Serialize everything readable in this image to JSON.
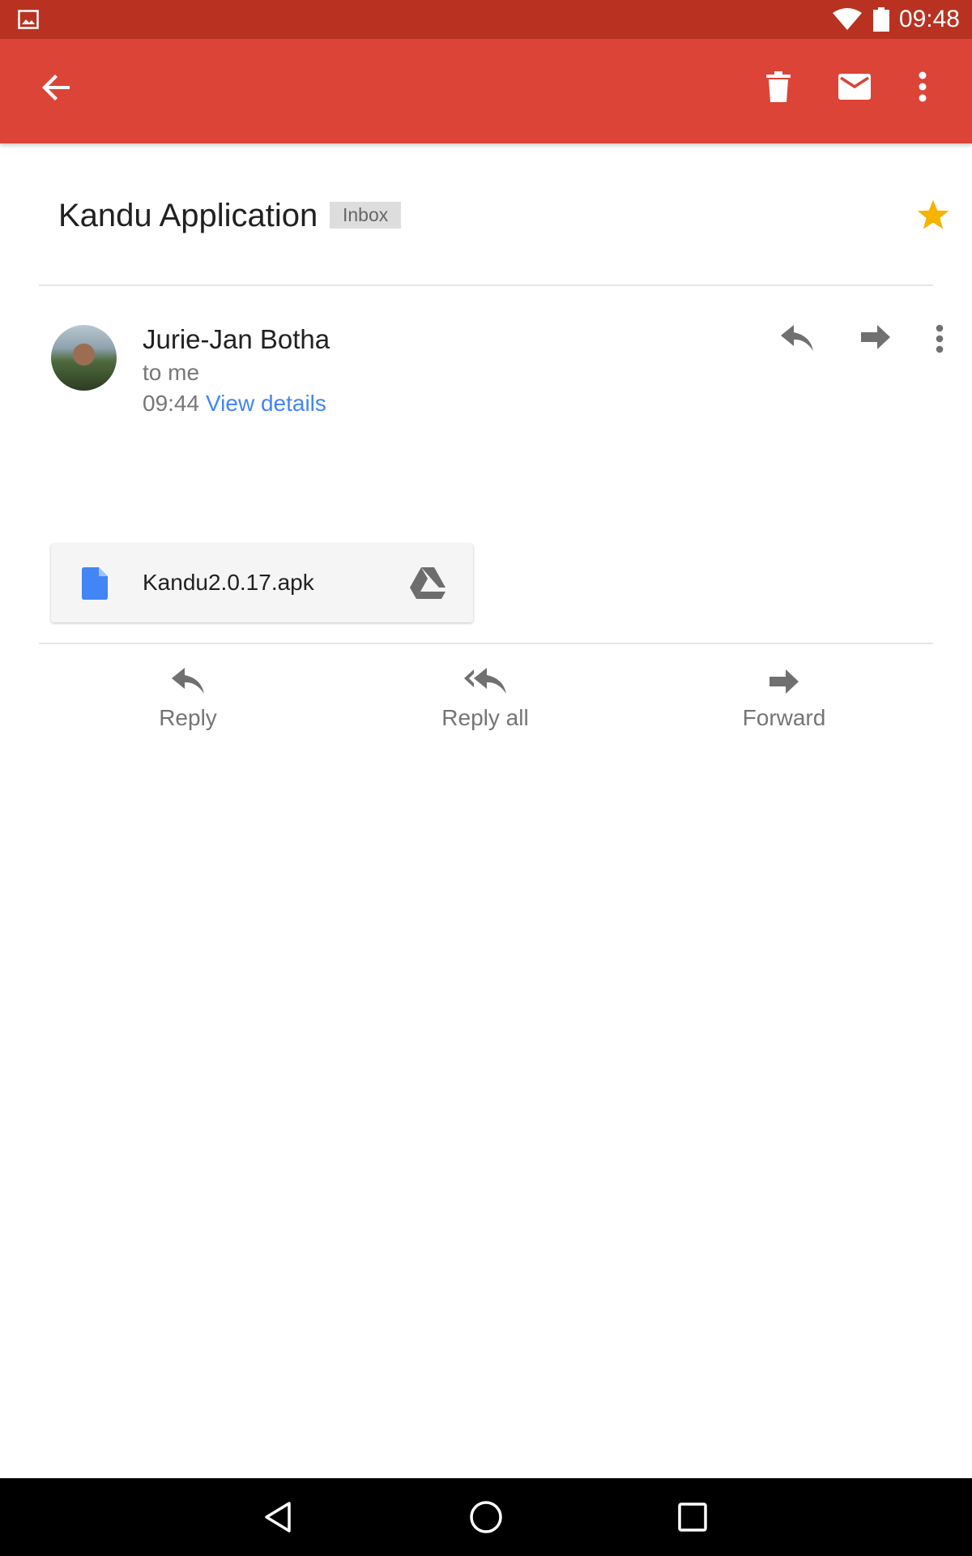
{
  "status_bar": {
    "time": "09:48",
    "icons": [
      "image-notification-icon",
      "wifi-icon",
      "battery-icon"
    ]
  },
  "toolbar": {
    "icons": [
      "back-arrow-icon",
      "delete-icon",
      "mail-icon",
      "more-vert-icon"
    ]
  },
  "email": {
    "subject": "Kandu Application",
    "label": "Inbox",
    "starred": true,
    "star_color": "#f4b400"
  },
  "sender": {
    "name": "Jurie-Jan Botha",
    "recipient": "to me",
    "time": "09:44",
    "details_link": "View details"
  },
  "attachment": {
    "filename": "Kandu2.0.17.apk",
    "file_icon": "file-icon",
    "file_icon_color": "#4285f4",
    "action_icon": "drive-icon"
  },
  "actions": {
    "reply": "Reply",
    "reply_all": "Reply all",
    "forward": "Forward"
  },
  "colors": {
    "toolbar": "#db4437",
    "status_bar": "#b93221",
    "link": "#4285f4"
  }
}
